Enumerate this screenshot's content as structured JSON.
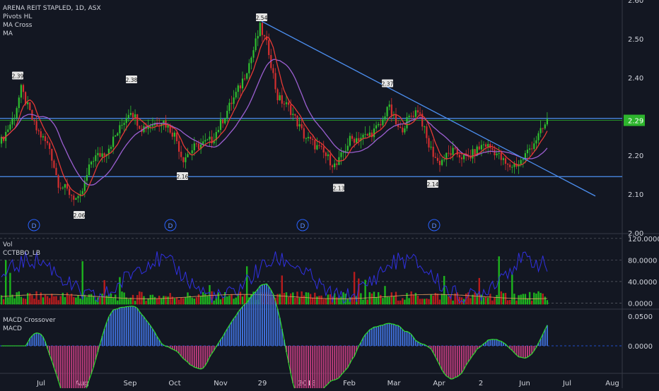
{
  "legend": {
    "title": "ARENA REIT STAPLED, 1D, ASX",
    "items": [
      "Pivots HL",
      "MA Cross",
      "MA"
    ]
  },
  "vol_legend": [
    "Vol",
    "CCTBBO_LB"
  ],
  "macd_legend": [
    "MACD Crossover",
    "MACD"
  ],
  "price_axis": {
    "ticks": [
      "2.60",
      "2.50",
      "2.40",
      "2.20",
      "2.10",
      "2.00"
    ],
    "last_price": "2.29"
  },
  "vol_axis": {
    "ticks": [
      "120.0000",
      "80.0000",
      "40.0000",
      "0.0000"
    ]
  },
  "macd_axis": {
    "ticks": [
      "0.0500",
      "0.0000"
    ]
  },
  "time_axis": {
    "labels": [
      "Jul",
      "Aug",
      "Sep",
      "Oct",
      "Nov",
      "29",
      "2018",
      "Feb",
      "Mar",
      "Apr",
      "2",
      "Jun",
      "Jul",
      "Aug"
    ]
  },
  "pivots": [
    "2.39",
    "2.06",
    "2.38",
    "2.16",
    "2.54",
    "2.13",
    "2.37",
    "2.14"
  ],
  "dividend_marker": "D",
  "colors": {
    "background": "#131722",
    "up": "#2fbf2f",
    "down": "#d32f2f",
    "trendline": "#4c8ff0",
    "ma_fast": "#e53935",
    "ma_slow": "#9c5fd1",
    "cci": "#3030e0",
    "macd": "#2ee62e",
    "price_tag": "#2db52d"
  },
  "chart_data": [
    {
      "type": "line",
      "panel": "price",
      "title": "ARENA REIT STAPLED, 1D, ASX",
      "ylim": [
        2.0,
        2.6
      ],
      "x": [
        "Jul",
        "Aug",
        "Sep",
        "Oct",
        "Nov",
        "29",
        "2018",
        "Feb",
        "Mar",
        "Apr",
        "2",
        "Jun"
      ],
      "series": [
        {
          "name": "MA Cross",
          "values": [
            2.24,
            2.1,
            2.29,
            2.24,
            2.32,
            2.5,
            2.28,
            2.21,
            2.27,
            2.16,
            2.21,
            2.18
          ]
        },
        {
          "name": "MA",
          "values": [
            2.25,
            2.13,
            2.26,
            2.26,
            2.27,
            2.4,
            2.32,
            2.22,
            2.26,
            2.22,
            2.19,
            2.2
          ]
        }
      ],
      "pivots": [
        {
          "label": "2.39",
          "value": 2.39
        },
        {
          "label": "2.06",
          "value": 2.06
        },
        {
          "label": "2.38",
          "value": 2.38
        },
        {
          "label": "2.16",
          "value": 2.16
        },
        {
          "label": "2.54",
          "value": 2.54
        },
        {
          "label": "2.13",
          "value": 2.13
        },
        {
          "label": "2.37",
          "value": 2.37
        },
        {
          "label": "2.14",
          "value": 2.14
        }
      ],
      "horizontal_lines": [
        2.295,
        2.145
      ],
      "last_price": 2.29
    },
    {
      "type": "bar",
      "panel": "volume",
      "series_names": [
        "Vol",
        "CCTBBO_LB"
      ],
      "ylim": [
        -10,
        125
      ],
      "yticks": [
        120,
        80,
        40,
        0
      ]
    },
    {
      "type": "bar",
      "panel": "macd",
      "series_names": [
        "MACD Crossover",
        "MACD"
      ],
      "ylim": [
        -0.045,
        0.058
      ],
      "yticks": [
        0.05,
        0.0
      ]
    }
  ]
}
